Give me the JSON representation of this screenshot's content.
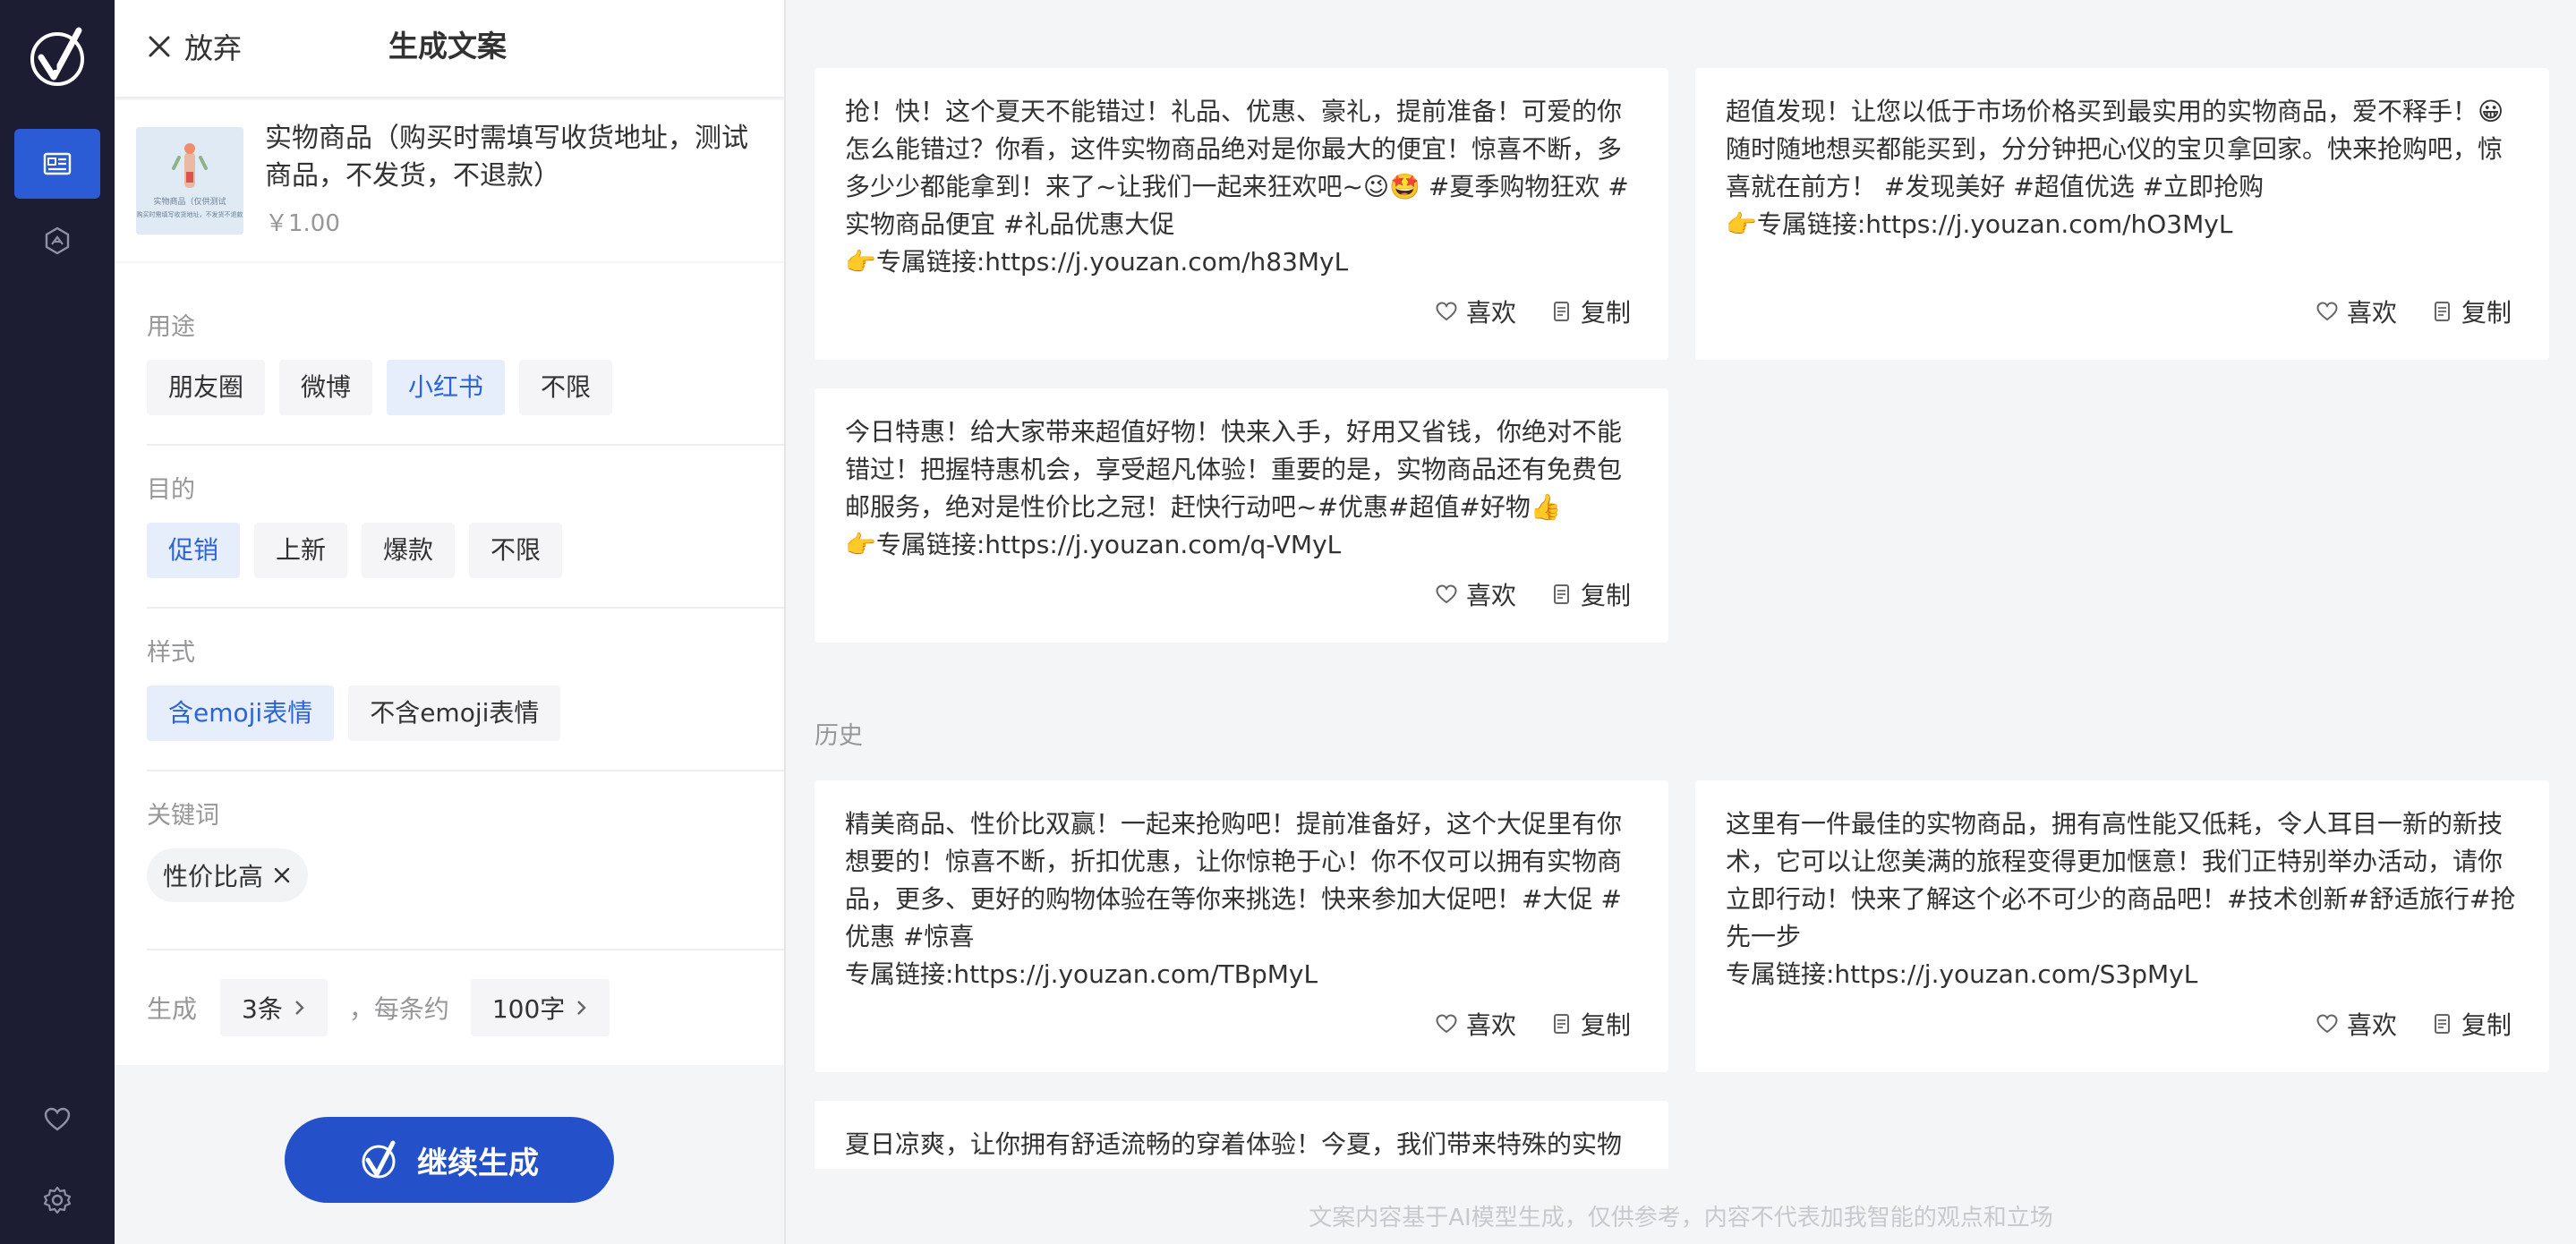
{
  "header": {
    "discard_label": "放弃",
    "title": "生成文案"
  },
  "product": {
    "name": "实物商品（购买时需填写收货地址，测试商品，不发货，不退款）",
    "price": "￥1.00",
    "thumb_caption_1": "实物商品（仅供测试",
    "thumb_caption_2": "购买时需填写收货地址，不发货不退款"
  },
  "usage": {
    "title": "用途",
    "options": [
      "朋友圈",
      "微博",
      "小红书",
      "不限"
    ],
    "selected": "小红书"
  },
  "purpose": {
    "title": "目的",
    "options": [
      "促销",
      "上新",
      "爆款",
      "不限"
    ],
    "selected": "促销"
  },
  "style": {
    "title": "样式",
    "options": [
      "含emoji表情",
      "不含emoji表情"
    ],
    "selected": "含emoji表情"
  },
  "keywords": {
    "title": "关键词",
    "tags": [
      "性价比高"
    ]
  },
  "generate": {
    "label": "生成",
    "count": "3条",
    "separator": "，每条约",
    "length": "100字"
  },
  "cta_label": "继续生成",
  "card_actions": {
    "like": "喜欢",
    "copy": "复制"
  },
  "results": [
    {
      "text": "抢！快！这个夏天不能错过！礼品、优惠、豪礼，提前准备！可爱的你怎么能错过？你看，这件实物商品绝对是你最大的便宜！惊喜不断，多多少少都能拿到！来了~让我们一起来狂欢吧~😉🤩 #夏季购物狂欢 #实物商品便宜 #礼品优惠大促\n👉专属链接:https://j.youzan.com/h83MyL"
    },
    {
      "text": "超值发现！让您以低于市场价格买到最实用的实物商品，爱不释手！😀随时随地想买都能买到，分分钟把心仪的宝贝拿回家。快来抢购吧，惊喜就在前方！ #发现美好 #超值优选 #立即抢购\n👉专属链接:https://j.youzan.com/hO3MyL"
    },
    {
      "text": "今日特惠！给大家带来超值好物！快来入手，好用又省钱，你绝对不能错过！把握特惠机会，享受超凡体验！重要的是，实物商品还有免费包邮服务，绝对是性价比之冠！赶快行动吧~#优惠#超值#好物👍\n👉专属链接:https://j.youzan.com/q-VMyL"
    }
  ],
  "history": {
    "title": "历史",
    "items": [
      {
        "text": "精美商品、性价比双赢！一起来抢购吧！提前准备好，这个大促里有你想要的！惊喜不断，折扣优惠，让你惊艳于心！你不仅可以拥有实物商品，更多、更好的购物体验在等你来挑选！快来参加大促吧！#大促 #优惠 #惊喜\n专属链接:https://j.youzan.com/TBpMyL"
      },
      {
        "text": "这里有一件最佳的实物商品，拥有高性能又低耗，令人耳目一新的新技术，它可以让您美满的旅程变得更加惬意！我们正特别举办活动，请你立即行动！快来了解这个必不可少的商品吧！#技术创新#舒适旅行#抢先一步\n专属链接:https://j.youzan.com/S3pMyL"
      },
      {
        "text": "夏日凉爽，让你拥有舒适流畅的穿着体验！今夏，我们带来特殊的实物"
      }
    ]
  },
  "footer_note": "文案内容基于AI模型生成，仅供参考，内容不代表加我智能的观点和立场",
  "colors": {
    "rail": "#1c1c33",
    "accent": "#2b5cd6",
    "cta": "#2451c9",
    "chip_selected_bg": "#e6eefc"
  },
  "icons": [
    "logo-check-icon",
    "copywriting-icon",
    "ai-creative-icon",
    "heart-icon",
    "settings-icon",
    "close-icon",
    "chevron-right-icon",
    "copy-icon"
  ]
}
